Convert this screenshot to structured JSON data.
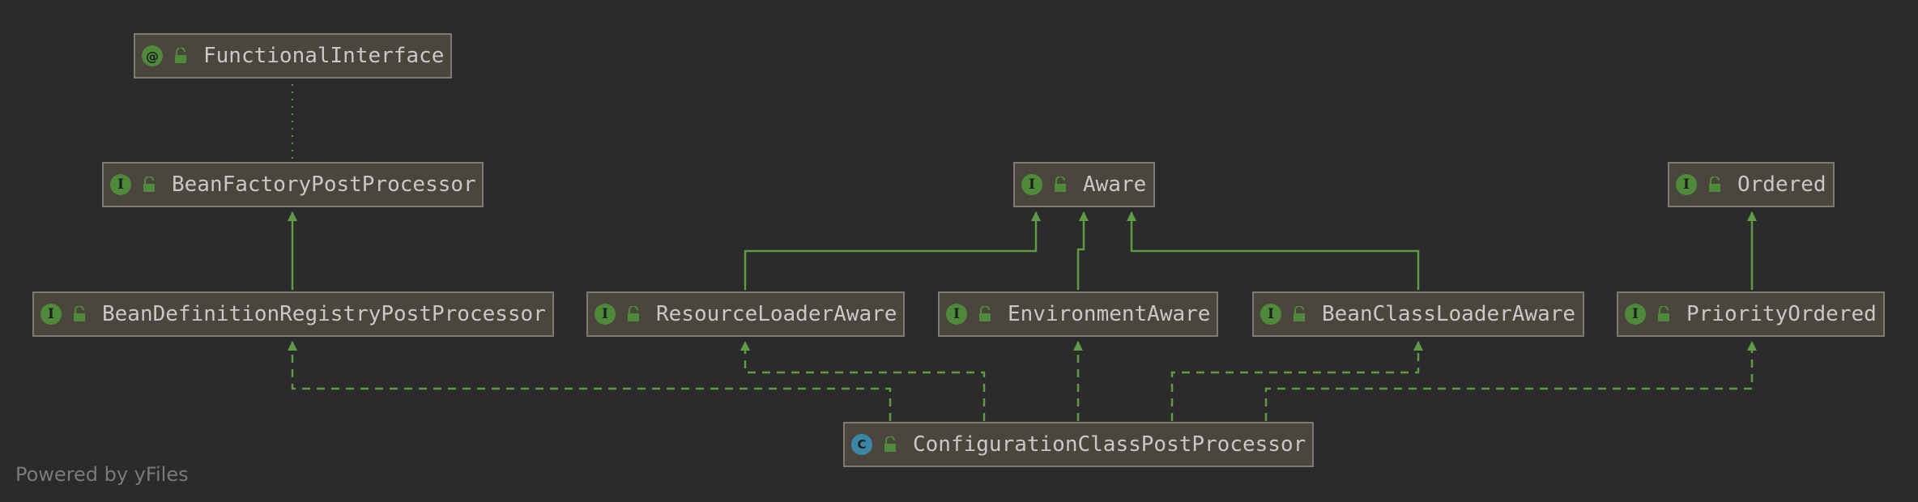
{
  "nodes": {
    "functional_interface": {
      "name": "FunctionalInterface",
      "kind": "@"
    },
    "bean_factory_post_processor": {
      "name": "BeanFactoryPostProcessor",
      "kind": "I"
    },
    "aware": {
      "name": "Aware",
      "kind": "I"
    },
    "ordered": {
      "name": "Ordered",
      "kind": "I"
    },
    "bean_definition_registry_post_processor": {
      "name": "BeanDefinitionRegistryPostProcessor",
      "kind": "I"
    },
    "resource_loader_aware": {
      "name": "ResourceLoaderAware",
      "kind": "I"
    },
    "environment_aware": {
      "name": "EnvironmentAware",
      "kind": "I"
    },
    "bean_class_loader_aware": {
      "name": "BeanClassLoaderAware",
      "kind": "I"
    },
    "priority_ordered": {
      "name": "PriorityOrdered",
      "kind": "I"
    },
    "configuration_class_post_processor": {
      "name": "ConfigurationClassPostProcessor",
      "kind": "C"
    }
  },
  "footer": {
    "credit": "Powered by yFiles"
  },
  "colors": {
    "background": "#2b2b2b",
    "node_fill": "#4a463d",
    "node_border": "#7c7a73",
    "text": "#c8c8c8",
    "interface_badge": "#4f8a3a",
    "class_badge": "#3a87a5",
    "edge": "#5f9a45"
  },
  "icons": {
    "interface": "interface-badge-icon",
    "class": "class-badge-icon",
    "annotation": "annotation-badge-icon",
    "visibility": "unlocked-padlock-icon"
  }
}
